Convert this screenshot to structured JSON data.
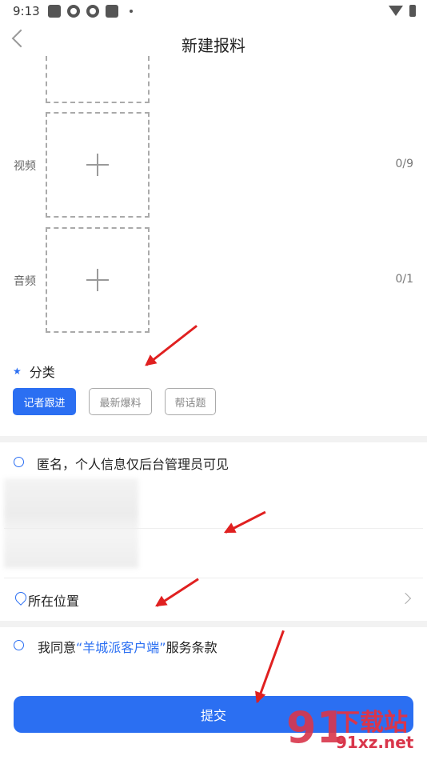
{
  "status_bar": {
    "time": "9:13"
  },
  "header": {
    "title": "新建报料"
  },
  "media": {
    "video": {
      "label": "视频",
      "count": "0/9"
    },
    "audio": {
      "label": "音频",
      "count": "0/1"
    }
  },
  "category": {
    "title": "分类",
    "chips": [
      "记者跟进",
      "最新爆料",
      "帮话题"
    ],
    "selected_index": 0
  },
  "anonymous": {
    "text": "匿名，个人信息仅后台管理员可见"
  },
  "location": {
    "label": "所在位置"
  },
  "agreement": {
    "prefix": "我同意",
    "link": "“羊城派客户端”",
    "suffix": "服务条款"
  },
  "submit": {
    "label": "提交"
  },
  "watermark": {
    "mark": "91",
    "cn": "下载站",
    "en": "91xz.net"
  },
  "colors": {
    "accent": "#2b6ff2",
    "annotation_arrow": "#e02020",
    "watermark": "#d9364b"
  },
  "icons": [
    "back-chevron-icon",
    "plus-icon",
    "star-icon",
    "radio-icon",
    "location-pin-icon",
    "chevron-right-icon"
  ]
}
